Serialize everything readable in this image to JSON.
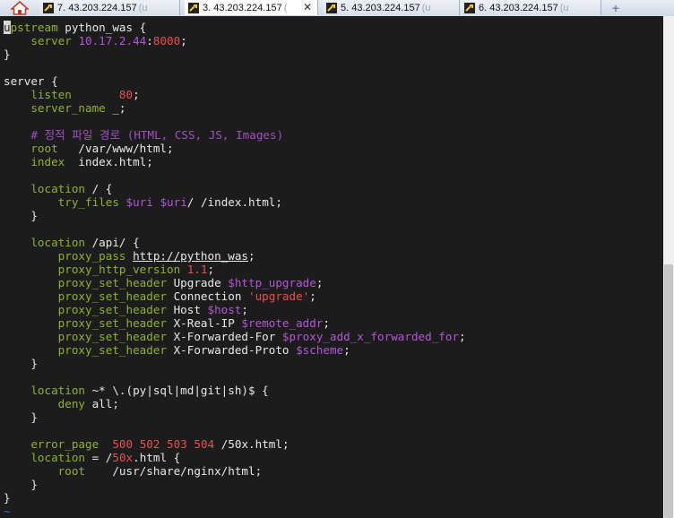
{
  "tabs": [
    {
      "label": "7. 43.203.224.157",
      "tail": "(u",
      "active": false
    },
    {
      "label": "3. 43.203.224.157",
      "tail": "(",
      "active": true,
      "close": "✕"
    },
    {
      "label": "5. 43.203.224.157",
      "tail": "(u",
      "active": false
    },
    {
      "label": "6. 43.203.224.157",
      "tail": "(u",
      "active": false
    }
  ],
  "new_tab_symbol": "+",
  "icons": {
    "home": "home-icon",
    "tab": "terminal-key-icon",
    "new_tab": "new-tab-icon"
  },
  "colors": {
    "background": "#1c1c1c",
    "keyword": "#8fb22a",
    "number": "#e84f4f",
    "variable": "#b455d9",
    "comment": "#a14fc4"
  },
  "editor": {
    "cursor_char": "u",
    "l1": {
      "rest": "pstream",
      "name": " python_was {"
    },
    "l2": {
      "kw": "server",
      "ip": "10.17.2.44",
      "port_sep": ":",
      "port": "8000",
      "end": ";"
    },
    "l3": "}",
    "l5": "server {",
    "l6": {
      "kw": "listen",
      "val": "80",
      "end": ";"
    },
    "l7": {
      "kw": "server_name",
      "val": " _;"
    },
    "l9": {
      "comment": "# 정적 파일 경로 (HTML, CSS, JS, Images)"
    },
    "l10": {
      "kw": "root",
      "val": "   /var/www/html;"
    },
    "l11": {
      "kw": "index",
      "val": "  index.html;"
    },
    "l13": {
      "kw": "location",
      "val": " / {"
    },
    "l14": {
      "kw": "try_files",
      "v1": "$uri",
      "v2": "$uri",
      "rest": "/ /index.html;"
    },
    "l15": "}",
    "l17": {
      "kw": "location",
      "val": " /api/ {"
    },
    "l18": {
      "kw": "proxy_pass",
      "url": "http://python_was",
      "end": ";"
    },
    "l19": {
      "kw": "proxy_http_version",
      "num": "1.1",
      "end": ";"
    },
    "l20": {
      "kw": "proxy_set_header",
      "name": " Upgrade ",
      "var": "$http_upgrade",
      "end": ";"
    },
    "l21": {
      "kw": "proxy_set_header",
      "name": " Connection ",
      "str": "'upgrade'",
      "end": ";"
    },
    "l22": {
      "kw": "proxy_set_header",
      "name": " Host ",
      "var": "$host",
      "end": ";"
    },
    "l23": {
      "kw": "proxy_set_header",
      "name": " X-Real-IP ",
      "var": "$remote_addr",
      "end": ";"
    },
    "l24": {
      "kw": "proxy_set_header",
      "name": " X-Forwarded-For ",
      "var": "$proxy_add_x_forwarded_for",
      "end": ";"
    },
    "l25": {
      "kw": "proxy_set_header",
      "name": " X-Forwarded-Proto ",
      "var": "$scheme",
      "end": ";"
    },
    "l26": "}",
    "l28": {
      "kw": "location",
      "val": " ~* \\.(py|sql|md|git|sh)$ {"
    },
    "l29": {
      "kw": "deny",
      "val": " all;"
    },
    "l30": "}",
    "l32": {
      "kw": "error_page",
      "n1": "500",
      "n2": "502",
      "n3": "503",
      "n4": "504",
      "rest": " /50x.html;"
    },
    "l33": {
      "kw": "location",
      "pre": " = /",
      "num": "50x",
      "rest": ".html {"
    },
    "l34": {
      "kw": "root",
      "val": "    /usr/share/nginx/html;"
    },
    "l35": "}",
    "l36": "}",
    "l37": "~"
  }
}
